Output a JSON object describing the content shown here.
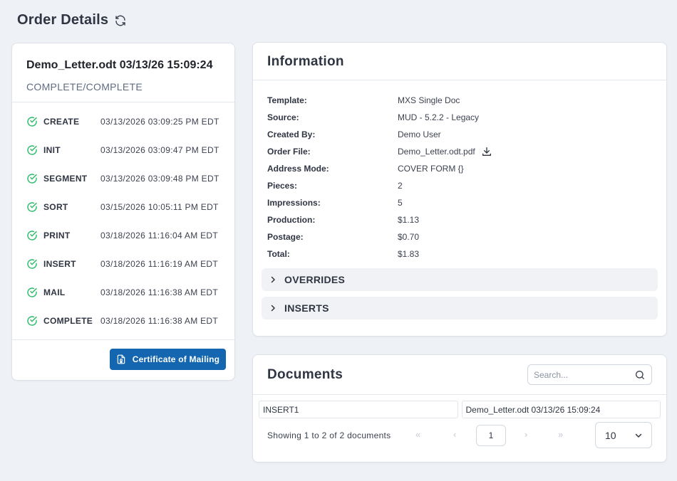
{
  "page": {
    "title": "Order Details"
  },
  "order": {
    "name": "Demo_Letter.odt 03/13/26 15:09:24",
    "status": "COMPLETE/COMPLETE",
    "steps": [
      {
        "name": "CREATE",
        "time": "03/13/2026 03:09:25 PM EDT"
      },
      {
        "name": "INIT",
        "time": "03/13/2026 03:09:47 PM EDT"
      },
      {
        "name": "SEGMENT",
        "time": "03/13/2026 03:09:48 PM EDT"
      },
      {
        "name": "SORT",
        "time": "03/15/2026 10:05:11 PM EDT"
      },
      {
        "name": "PRINT",
        "time": "03/18/2026 11:16:04 AM EDT"
      },
      {
        "name": "INSERT",
        "time": "03/18/2026 11:16:19 AM EDT"
      },
      {
        "name": "MAIL",
        "time": "03/18/2026 11:16:38 AM EDT"
      },
      {
        "name": "COMPLETE",
        "time": "03/18/2026 11:16:38 AM EDT"
      }
    ],
    "certificate_button": "Certificate of Mailing"
  },
  "information": {
    "title": "Information",
    "rows": [
      {
        "label": "Template:",
        "value": "MXS Single Doc"
      },
      {
        "label": "Source:",
        "value": "MUD - 5.2.2 - Legacy"
      },
      {
        "label": "Created By:",
        "value": "Demo User"
      },
      {
        "label": "Order File:",
        "value": "Demo_Letter.odt.pdf"
      },
      {
        "label": "Address Mode:",
        "value": "COVER FORM {}"
      },
      {
        "label": "Pieces:",
        "value": "2"
      },
      {
        "label": "Impressions:",
        "value": "5"
      },
      {
        "label": "Production:",
        "value": "$1.13"
      },
      {
        "label": "Postage:",
        "value": "$0.70"
      },
      {
        "label": "Total:",
        "value": "$1.83"
      }
    ],
    "sections": [
      "OVERRIDES",
      "INSERTS"
    ]
  },
  "documents": {
    "title": "Documents",
    "search_placeholder": "Search...",
    "row": [
      "INSERT1",
      "Demo_Letter.odt 03/13/26 15:09:24"
    ],
    "showing": "Showing 1 to 2 of 2 documents",
    "pager": {
      "first": "«",
      "prev": "‹",
      "current": "1",
      "next": "›",
      "last": "»"
    },
    "page_size": "10"
  },
  "colors": {
    "accent": "#1466b0",
    "success": "#2ebd6b",
    "background": "#eef1f6"
  }
}
